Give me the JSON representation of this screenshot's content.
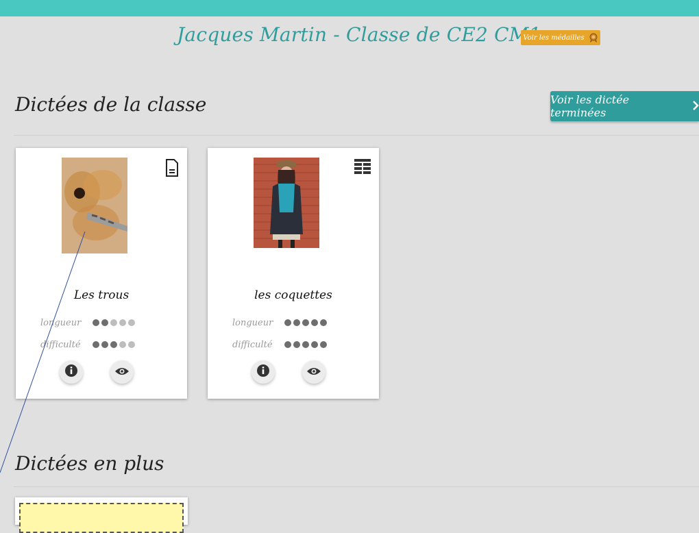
{
  "header": {
    "title": "Jacques Martin - Classe de CE2 CM1",
    "medals_label": "Voir les médailles"
  },
  "sections": {
    "class_title": "Dictées de la classe",
    "extra_title": "Dictées en plus",
    "view_done_label": "Voir les dictée terminées"
  },
  "labels": {
    "length": "longueur",
    "difficulty": "difficulté"
  },
  "cards": [
    {
      "title": "Les trous",
      "type_icon": "document-icon",
      "length": 2,
      "difficulty": 3
    },
    {
      "title": "les coquettes",
      "type_icon": "table-icon",
      "length": 5,
      "difficulty": 5
    }
  ],
  "colors": {
    "accent": "#2f9d9c",
    "topbar": "#48c8c0",
    "medals": "#e7a62a",
    "background": "#e0e0e0"
  }
}
